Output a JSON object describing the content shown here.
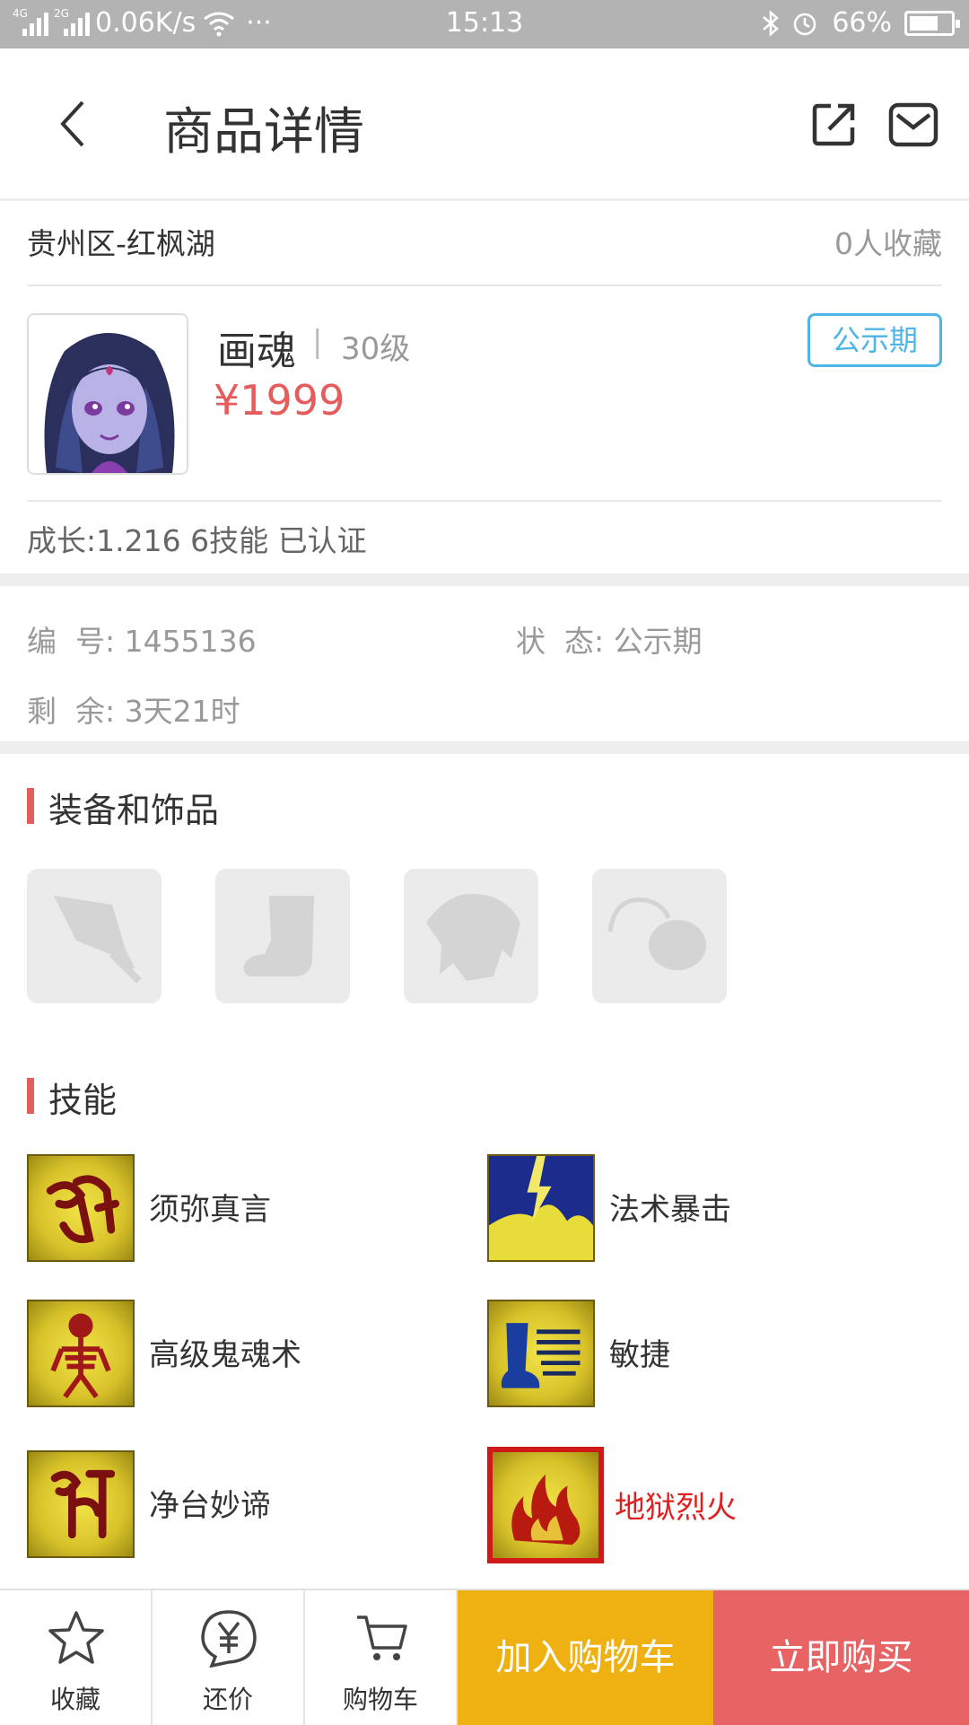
{
  "status_bar": {
    "net_4g": "4G",
    "net_2g": "2G",
    "speed": "0.06K/s",
    "more": "···",
    "time": "15:13",
    "battery": "66%"
  },
  "nav": {
    "title": "商品详情"
  },
  "server": {
    "location": "贵州区-红枫湖",
    "favorites": "0人收藏"
  },
  "product": {
    "name": "画魂",
    "separator": "|",
    "level": "30级",
    "price": "¥1999",
    "badge": "公示期"
  },
  "growth": "成长:1.216 6技能 已认证",
  "details": {
    "id_label": "编  号:",
    "id_value": "1455136",
    "status_label": "状  态:",
    "status_value": "公示期",
    "remaining_label": "剩  余:",
    "remaining_value": "3天21时"
  },
  "equipment": {
    "title": "装备和饰品",
    "slots": [
      "weapon-icon",
      "boots-icon",
      "armor-icon",
      "accessory-icon"
    ]
  },
  "skills": {
    "title": "技能",
    "items": [
      {
        "name": "须弥真言",
        "icon": "sanskrit-icon"
      },
      {
        "name": "法术暴击",
        "icon": "lightning-icon"
      },
      {
        "name": "高级鬼魂术",
        "icon": "skeleton-icon"
      },
      {
        "name": "敏捷",
        "icon": "boot-speed-icon"
      },
      {
        "name": "净台妙谛",
        "icon": "sanskrit-icon"
      },
      {
        "name": "地狱烈火",
        "icon": "fire-icon",
        "highlight_color": "#e02020"
      }
    ]
  },
  "bottom_bar": {
    "favorite": "收藏",
    "bargain": "还价",
    "cart": "购物车",
    "add_to_cart": "加入购物车",
    "buy_now": "立即购买"
  },
  "colors": {
    "accent_red": "#e65b5b",
    "badge_blue": "#4fb5e5",
    "cart_yellow": "#eeb111",
    "buy_red": "#e86464"
  }
}
